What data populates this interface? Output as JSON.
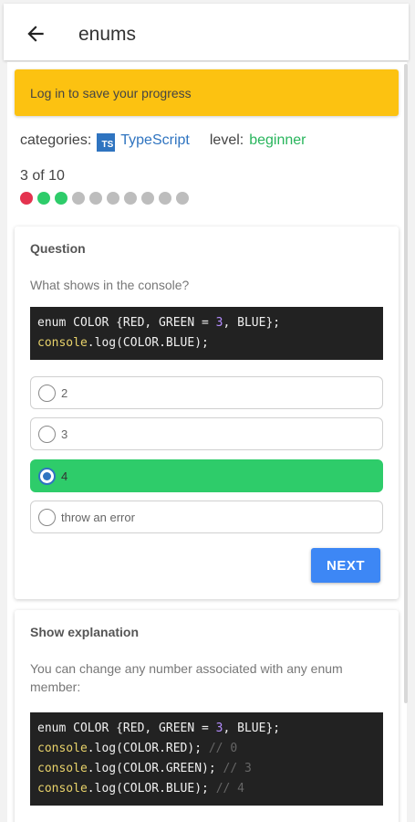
{
  "app": {
    "title": "enums"
  },
  "banner": {
    "text": "Log in to save your progress",
    "color": "#fcc211"
  },
  "meta": {
    "categories_label": "categories:",
    "category_badge": "TS",
    "category": "TypeScript",
    "level_label": "level:",
    "level": "beginner"
  },
  "progress": {
    "text": "3 of 10",
    "dots": [
      "incorrect",
      "correct",
      "correct",
      "pending",
      "pending",
      "pending",
      "pending",
      "pending",
      "pending",
      "pending"
    ],
    "colors": {
      "incorrect": "#e4334f",
      "correct": "#2ecc6a",
      "pending": "#bdbdbd"
    }
  },
  "question": {
    "heading": "Question",
    "prompt": "What shows in the console?",
    "code_lines": [
      [
        {
          "t": "enum COLOR {RED, GREEN = ",
          "c": "kw"
        },
        {
          "t": "3",
          "c": "num"
        },
        {
          "t": ", BLUE};",
          "c": "kw"
        }
      ],
      [
        {
          "t": "console",
          "c": "fn"
        },
        {
          "t": ".log(COLOR.BLUE);",
          "c": "kw"
        }
      ]
    ],
    "options": [
      {
        "label": "2",
        "selected": false
      },
      {
        "label": "3",
        "selected": false
      },
      {
        "label": "4",
        "selected": true
      },
      {
        "label": "throw an error",
        "selected": false
      }
    ],
    "next_label": "NEXT"
  },
  "explanation": {
    "heading": "Show explanation",
    "text": "You can change any number associated with any enum member:",
    "code_lines": [
      [
        {
          "t": "enum COLOR {RED, GREEN = ",
          "c": "kw"
        },
        {
          "t": "3",
          "c": "num"
        },
        {
          "t": ", BLUE};",
          "c": "kw"
        }
      ],
      [
        {
          "t": "console",
          "c": "fn"
        },
        {
          "t": ".log(COLOR.RED); ",
          "c": "kw"
        },
        {
          "t": "// 0",
          "c": "cm"
        }
      ],
      [
        {
          "t": "console",
          "c": "fn"
        },
        {
          "t": ".log(COLOR.GREEN); ",
          "c": "kw"
        },
        {
          "t": "// 3",
          "c": "cm"
        }
      ],
      [
        {
          "t": "console",
          "c": "fn"
        },
        {
          "t": ".log(COLOR.BLUE); ",
          "c": "kw"
        },
        {
          "t": "// 4",
          "c": "cm"
        }
      ]
    ]
  }
}
